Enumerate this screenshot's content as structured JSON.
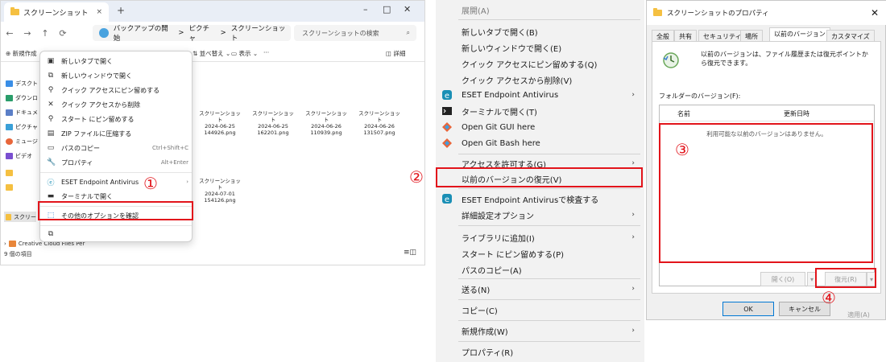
{
  "explorer": {
    "tab_title": "スクリーンショット",
    "tab_close": "×",
    "new_tab": "+",
    "win_min": "–",
    "win_max": "□",
    "win_close": "✕",
    "nav_back": "←",
    "nav_forward": "→",
    "nav_up": "↑",
    "nav_refresh": "⟳",
    "breadcrumb": [
      "バックアップの開始",
      ">",
      "ピクチャ",
      ">",
      "スクリーンショット"
    ],
    "search_placeholder": "スクリーンショットの検索",
    "cmd_new": "⊕ 新規作成",
    "cmd_sort": "⇅ 並べ替え ⌄",
    "cmd_view": "▭ 表示 ⌄",
    "cmd_more": "···",
    "cmd_details": "◫ 詳細",
    "sidebar": [
      "デスクト",
      "ダウンロ",
      "ドキュメ",
      "ピクチャ",
      "ミュージ",
      "ビデオ",
      "",
      "",
      "スクリー"
    ],
    "files": [
      {
        "name": "スクリーンショット",
        "date": "2024-06-25",
        "file": "144926.png"
      },
      {
        "name": "スクリーンショット",
        "date": "2024-06-25",
        "file": "162201.png"
      },
      {
        "name": "スクリーンショット",
        "date": "2024-06-26",
        "file": "110939.png"
      },
      {
        "name": "スクリーンショット",
        "date": "2024-06-26",
        "file": "131507.png"
      },
      {
        "name": "スクリーンショット",
        "date": "2024-07-01",
        "file": "154126.png"
      }
    ],
    "tree_item": "Creative Cloud Files Per",
    "status_count": "9 個の項目",
    "context_menu": [
      {
        "icon": "▣",
        "label": "新しいタブで開く",
        "accel": ""
      },
      {
        "icon": "⧉",
        "label": "新しいウィンドウで開く",
        "accel": ""
      },
      {
        "icon": "⚲",
        "label": "クイック アクセスにピン留めする",
        "accel": ""
      },
      {
        "icon": "✕",
        "label": "クイック アクセスから削除",
        "accel": ""
      },
      {
        "icon": "⚲",
        "label": "スタート にピン留めする",
        "accel": ""
      },
      {
        "icon": "▤",
        "label": "ZIP ファイルに圧縮する",
        "accel": ""
      },
      {
        "icon": "▭",
        "label": "パスのコピー",
        "accel": "Ctrl+Shift+C"
      },
      {
        "icon": "🔧",
        "label": "プロパティ",
        "accel": "Alt+Enter"
      },
      {
        "icon": "ⓔ",
        "label": "ESET Endpoint Antivirus",
        "accel": "›"
      },
      {
        "icon": "▬",
        "label": "ターミナルで開く",
        "accel": ""
      },
      {
        "icon": "⬚",
        "label": "その他のオプションを確認",
        "accel": ""
      },
      {
        "icon": "⧉",
        "label": "",
        "accel": ""
      }
    ],
    "step": "①"
  },
  "classic_menu": {
    "items": [
      {
        "label": "展開(A)",
        "grey": true,
        "arrow": ""
      },
      {
        "label": "新しいタブで開く(B)",
        "grey": false,
        "arrow": ""
      },
      {
        "label": "新しいウィンドウで開く(E)",
        "grey": false,
        "arrow": ""
      },
      {
        "label": "クイック アクセスにピン留めする(Q)",
        "grey": false,
        "arrow": ""
      },
      {
        "label": "クイック アクセスから削除(V)",
        "grey": false,
        "arrow": ""
      },
      {
        "label": "ESET Endpoint Antivirus",
        "grey": false,
        "arrow": "›"
      },
      {
        "label": "ターミナルで開く(T)",
        "grey": false,
        "arrow": ""
      },
      {
        "label": "Open Git GUI here",
        "grey": false,
        "arrow": ""
      },
      {
        "label": "Open Git Bash here",
        "grey": false,
        "arrow": ""
      },
      {
        "label": "アクセスを許可する(G)",
        "grey": false,
        "arrow": "›"
      },
      {
        "label": "以前のバージョンの復元(V)",
        "grey": false,
        "arrow": ""
      },
      {
        "label": "ESET Endpoint Antivirusで検査する",
        "grey": false,
        "arrow": ""
      },
      {
        "label": "詳細設定オプション",
        "grey": false,
        "arrow": "›"
      },
      {
        "label": "ライブラリに追加(I)",
        "grey": false,
        "arrow": "›"
      },
      {
        "label": "スタート にピン留めする(P)",
        "grey": false,
        "arrow": ""
      },
      {
        "label": "パスのコピー(A)",
        "grey": false,
        "arrow": ""
      },
      {
        "label": "送る(N)",
        "grey": false,
        "arrow": "›"
      },
      {
        "label": "コピー(C)",
        "grey": false,
        "arrow": ""
      },
      {
        "label": "新規作成(W)",
        "grey": false,
        "arrow": "›"
      },
      {
        "label": "プロパティ(R)",
        "grey": false,
        "arrow": ""
      }
    ],
    "step": "②"
  },
  "properties": {
    "title": "スクリーンショットのプロパティ",
    "close": "✕",
    "tabs": [
      "全般",
      "共有",
      "セキュリティ",
      "場所",
      "以前のバージョン",
      "カスタマイズ"
    ],
    "description": "以前のバージョンは、ファイル履歴または復元ポイントから復元できます。",
    "list_label": "フォルダーのバージョン(F):",
    "col_name": "名前",
    "col_date": "更新日時",
    "empty_message": "利用可能な以前のバージョンはありません。",
    "open_btn": "開く(O)",
    "restore_btn": "復元(R)",
    "dropdown": "▾",
    "ok_btn": "OK",
    "cancel_btn": "キャンセル",
    "apply_btn": "適用(A)",
    "step3": "③",
    "step4": "④"
  }
}
